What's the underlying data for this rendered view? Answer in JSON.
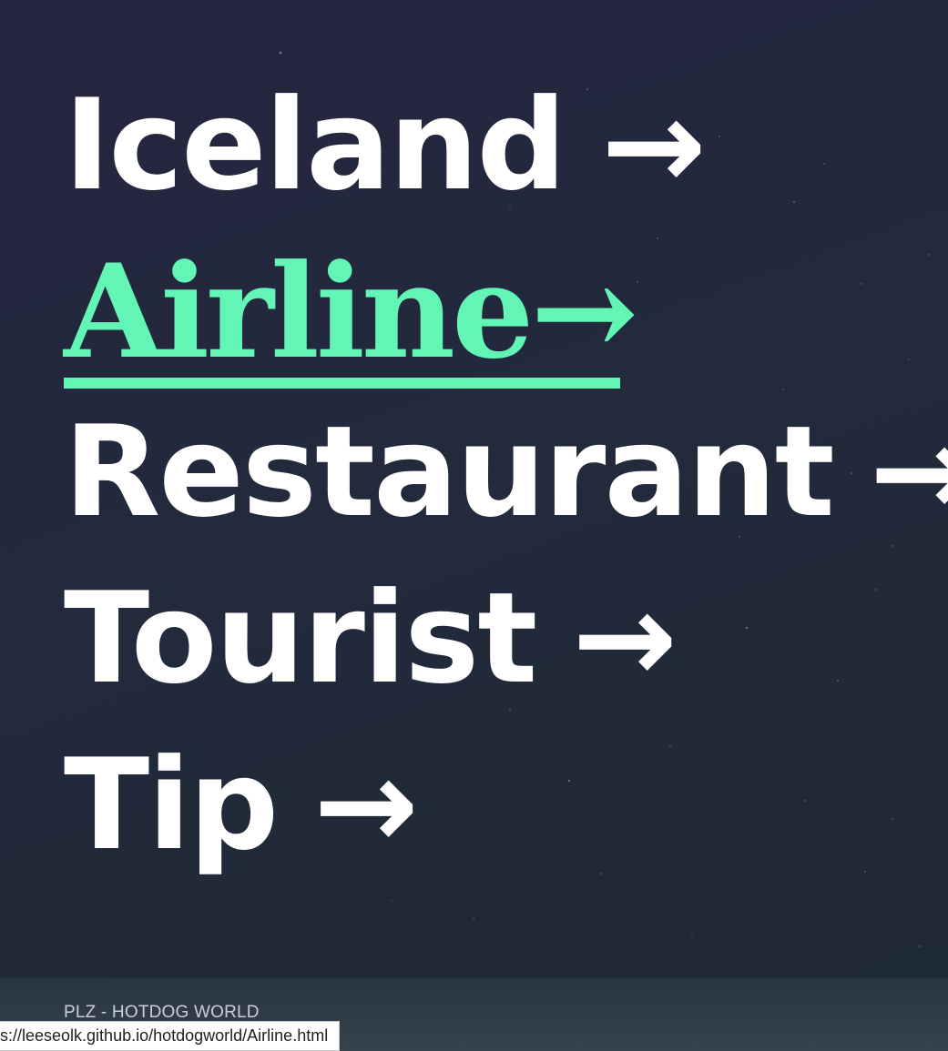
{
  "nav": {
    "items": [
      {
        "label": "Iceland",
        "arrow": "→",
        "active": false
      },
      {
        "label": "Airline",
        "arrow": "→",
        "active": true
      },
      {
        "label": "Restaurant",
        "arrow": "→",
        "active": false
      },
      {
        "label": "Tourist",
        "arrow": "→",
        "active": false
      },
      {
        "label": "Tip",
        "arrow": "→",
        "active": false
      }
    ]
  },
  "colors": {
    "active": "#62f5b6",
    "text": "#ffffff",
    "background": "#232a3c"
  },
  "footer": {
    "text": "PLZ - HOTDOG WORLD"
  },
  "status_bar": {
    "url": "s://leeseolk.github.io/hotdogworld/Airline.html"
  }
}
